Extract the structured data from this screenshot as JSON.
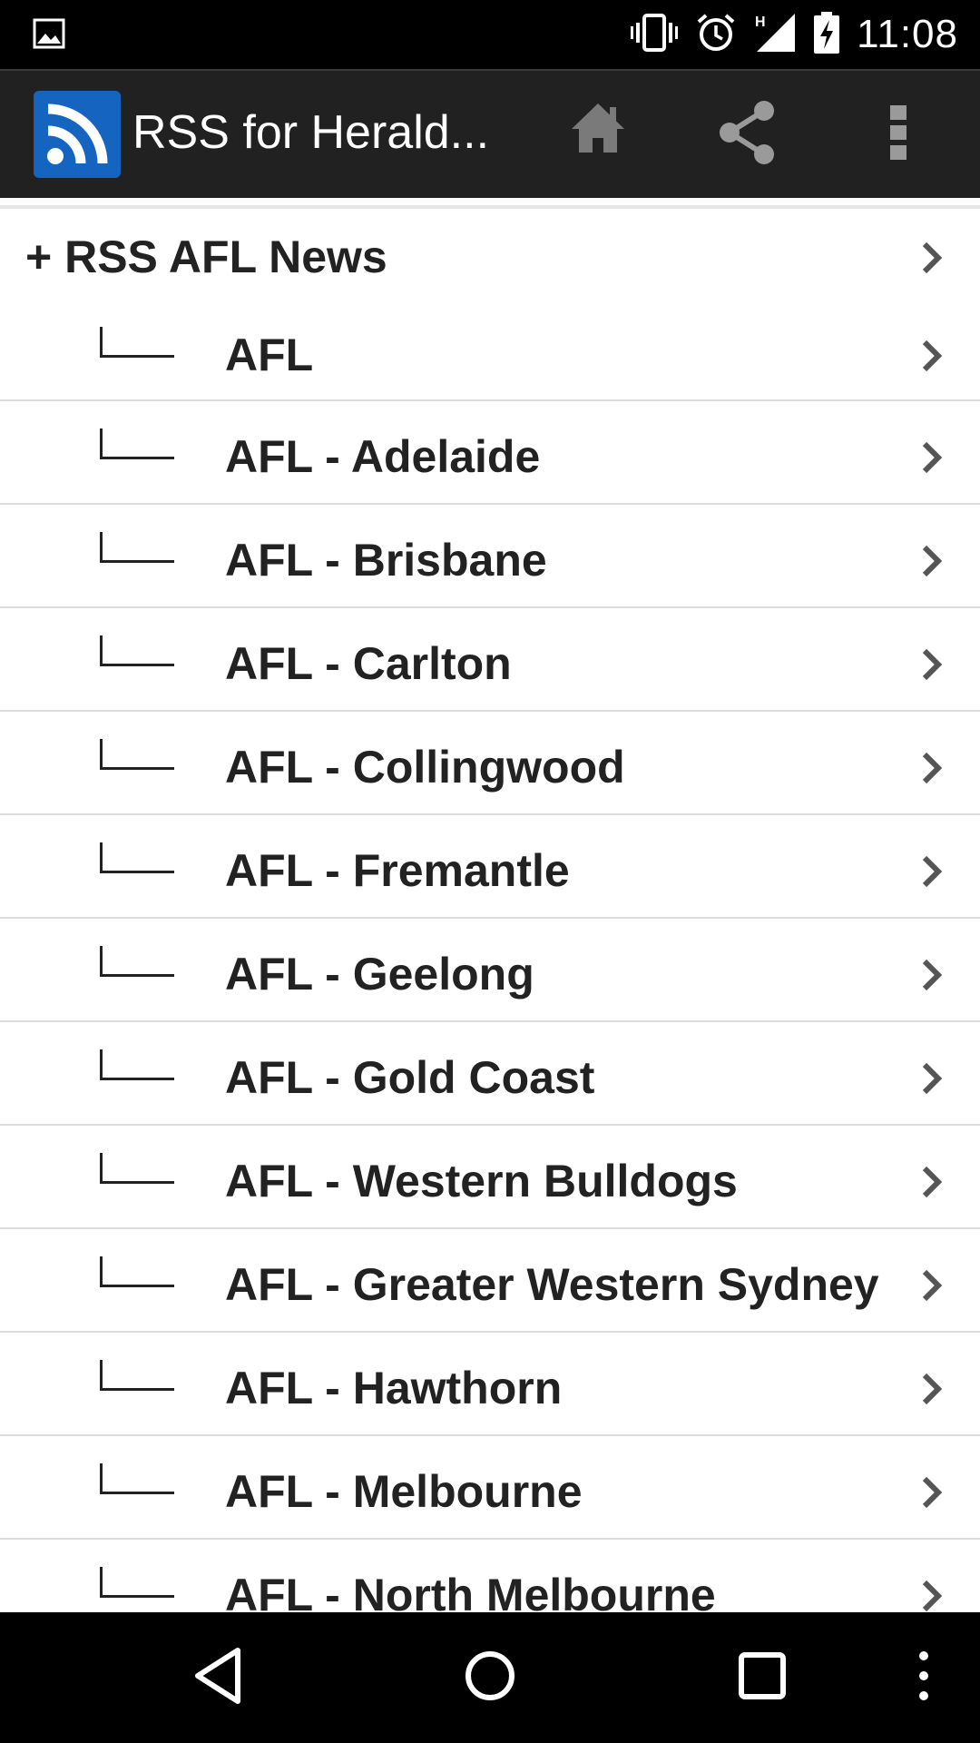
{
  "status_bar": {
    "time": "11:08",
    "network_type": "H",
    "icons": [
      "gallery-icon",
      "vibrate-icon",
      "alarm-icon",
      "signal-icon",
      "battery-charging-icon"
    ]
  },
  "app_bar": {
    "title": "RSS for Herald...",
    "actions": [
      "home-icon",
      "share-icon",
      "overflow-menu-icon"
    ],
    "accent_color": "#1565c0",
    "background_color": "#212121"
  },
  "list": {
    "group_label": "+ RSS AFL News",
    "items": [
      {
        "label": "AFL"
      },
      {
        "label": "AFL - Adelaide"
      },
      {
        "label": "AFL - Brisbane"
      },
      {
        "label": "AFL - Carlton"
      },
      {
        "label": "AFL - Collingwood"
      },
      {
        "label": "AFL - Fremantle"
      },
      {
        "label": "AFL - Geelong"
      },
      {
        "label": "AFL - Gold Coast"
      },
      {
        "label": "AFL - Western Bulldogs"
      },
      {
        "label": "AFL - Greater Western Sydney"
      },
      {
        "label": "AFL - Hawthorn"
      },
      {
        "label": "AFL - Melbourne"
      },
      {
        "label": "AFL - North Melbourne"
      }
    ]
  },
  "nav_bar": {
    "buttons": [
      "back-icon",
      "home-circle-icon",
      "recents-icon",
      "menu-dots-icon"
    ]
  }
}
